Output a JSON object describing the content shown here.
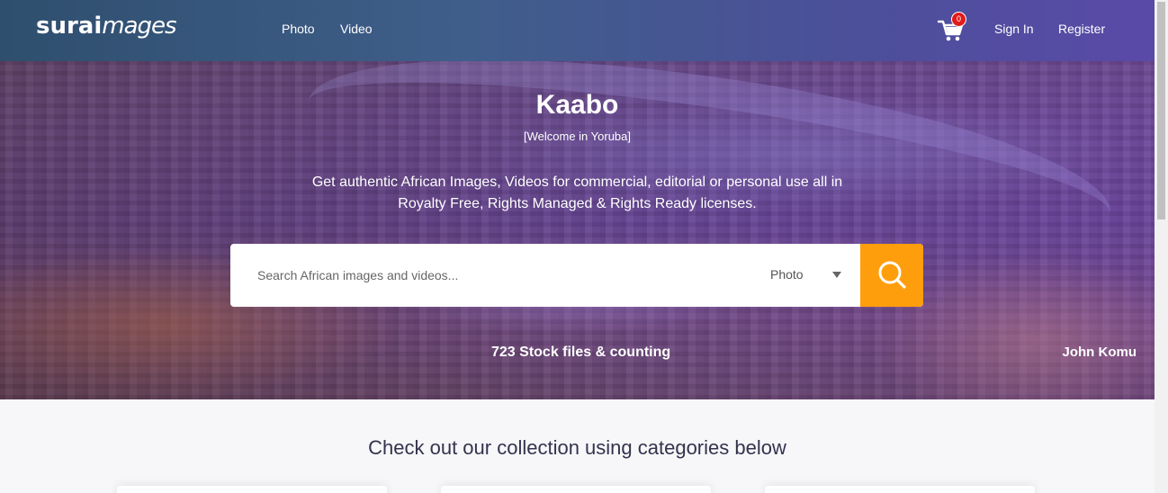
{
  "header": {
    "logo_part1": "surai",
    "logo_part2": "mages",
    "nav": [
      "Photo",
      "Video"
    ],
    "cart_count": "0",
    "sign_in": "Sign In",
    "register": "Register"
  },
  "hero": {
    "title": "Kaabo",
    "subtitle": "[Welcome in Yoruba]",
    "tagline": "Get authentic African Images, Videos for commercial, editorial or personal use all in Royalty Free, Rights Managed & Rights Ready licenses.",
    "search_placeholder": "Search African images and videos...",
    "search_type": "Photo",
    "stats": "723 Stock files & counting",
    "credit": "John Komu"
  },
  "categories": {
    "heading": "Check out our collection using categories below"
  },
  "colors": {
    "accent": "#ff9e0d",
    "badge": "#e01b1b"
  }
}
